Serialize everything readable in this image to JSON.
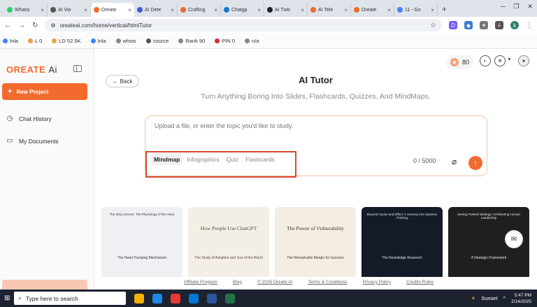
{
  "browser": {
    "tabs": [
      {
        "label": "Whatsi",
        "color": "#25d366"
      },
      {
        "label": "AI Vio",
        "color": "#555555"
      },
      {
        "label": "Oreate",
        "color": "#f26a2e",
        "active": true
      },
      {
        "label": "AI Dete",
        "color": "#3b5bdb"
      },
      {
        "label": "Crafting",
        "color": "#f26a2e"
      },
      {
        "label": "Chatgp",
        "color": "#1976d2"
      },
      {
        "label": "AI Tuto",
        "color": "#222222"
      },
      {
        "label": "AI Tele",
        "color": "#f26a2e"
      },
      {
        "label": "Oreate",
        "color": "#f26a2e"
      },
      {
        "label": "11 - Go",
        "color": "#4285f4"
      }
    ],
    "new_tab": "+",
    "url": "oreateai.com/home/vertical/htmlTutor",
    "profile_initial": "k"
  },
  "seo_bar": [
    {
      "label": "Inla",
      "color": "#4285f4"
    },
    {
      "label": "L 0",
      "color": "#e8a33d"
    },
    {
      "label": "LD 52.5K",
      "color": "#e8a33d"
    },
    {
      "label": "Inla",
      "color": "#4285f4"
    },
    {
      "label": "whois",
      "color": "#888888"
    },
    {
      "label": "source",
      "color": "#555555"
    },
    {
      "label": "Rank 90",
      "color": "#888888"
    },
    {
      "label": "PIN 0",
      "color": "#d32f2f"
    },
    {
      "label": "n/a",
      "color": "#888888"
    }
  ],
  "sidebar": {
    "logo_text": "OREATE",
    "logo_ai": "Ai",
    "new_project": "New Project",
    "items": [
      {
        "label": "Chat History",
        "icon": "clock-icon"
      },
      {
        "label": "My Documents",
        "icon": "folder-icon"
      }
    ]
  },
  "header": {
    "back": "Back",
    "credits": "80",
    "title": "AI Tutor",
    "subtitle": "Turn Anything Boring Into Slides, Flashcards, Quizzes, And MindMaps."
  },
  "composer": {
    "placeholder": "Upload a file, or enter the topic you'd like to study.",
    "modes": [
      "Mindmap",
      "Infographics",
      "Quiz",
      "Flashcards"
    ],
    "selected_mode": "Mindmap",
    "counter": "0 / 5000"
  },
  "cards": [
    {
      "title": "",
      "sub": "The Dirty Secrets: The Physiology of the Heart",
      "foot": "The Heart Pumping Mechanism",
      "bg": "#eef0f3",
      "fg": "#333333"
    },
    {
      "title": "How People Use ChatGPT",
      "sub": "",
      "foot": "The Study of Adoption and Use of the World",
      "bg": "#f4efe6",
      "fg": "#5a4a3a"
    },
    {
      "title": "The Power of Vulnerability",
      "sub": "",
      "foot": "The Remarkable Margin for Success",
      "bg": "#f3ede4",
      "fg": "#3a342c"
    },
    {
      "title": "",
      "sub": "Beyond Cause and Effect: A Journey into Systems Thinking",
      "foot": "The Knowledge Research",
      "bg": "#141a28",
      "fg": "#dfe6f5"
    },
    {
      "title": "",
      "sub": "Seeing Painted Strategy: Architecting Human Leadership",
      "foot": "A Strategic Framework",
      "bg": "#1f1f22",
      "fg": "#e8e8e8"
    }
  ],
  "footer": [
    "Affiliate Program",
    "Blog",
    "© 2026 Oreate AI",
    "Terms & Conditions",
    "Privacy Policy",
    "Credits Rules"
  ],
  "taskbar": {
    "search_placeholder": "Type here to search",
    "weather": "Sunset",
    "time": "5:47 PM",
    "date": "2/14/2025"
  }
}
